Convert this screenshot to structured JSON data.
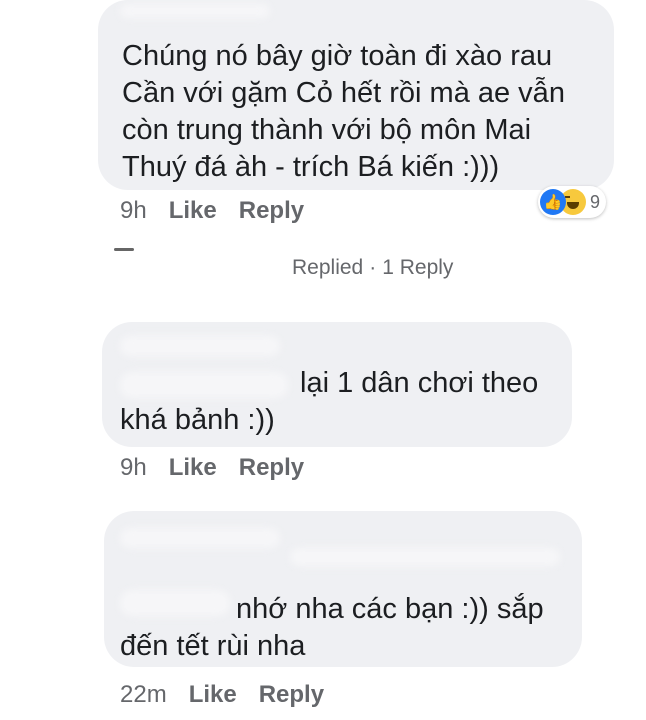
{
  "comments": [
    {
      "text_lines": [
        "Chúng nó bây giờ toàn đi xào rau",
        "Cần  với gặm Cỏ hết rồi mà ae vẫn",
        "còn trung thành với bộ môn Mai",
        "Thuý đá àh - trích Bá kiến :)))"
      ],
      "time": "9h",
      "like_label": "Like",
      "reply_label": "Reply",
      "reaction_count": "9"
    },
    {
      "text_lines": [
        "lại 1 dân chơi theo",
        "khá bảnh :))"
      ],
      "time": "9h",
      "like_label": "Like",
      "reply_label": "Reply"
    },
    {
      "text_lines": [
        "nhớ nha các bạn :)) sắp",
        "đến tết rùi nha"
      ],
      "time": "22m",
      "like_label": "Like",
      "reply_label": "Reply"
    }
  ],
  "replied_label": "Replied",
  "reply_count_label": "1 Reply",
  "icons": {
    "like": "like-reaction-icon",
    "haha": "haha-reaction-icon"
  },
  "colors": {
    "bubble": "#eff0f3",
    "meta_text": "#65676b",
    "like_blue": "#2078f4",
    "haha_yellow": "#f7c93d"
  }
}
